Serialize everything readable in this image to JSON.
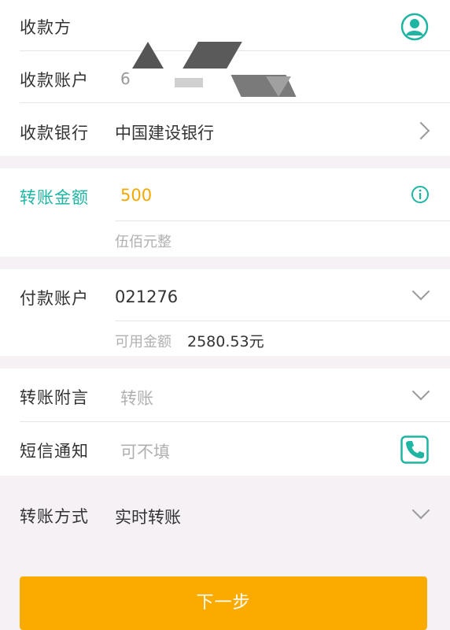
{
  "payee": {
    "label": "收款方",
    "icon": "contact-icon"
  },
  "payee_account": {
    "label": "收款账户",
    "value_visible": "6"
  },
  "payee_bank": {
    "label": "收款银行",
    "value": "中国建设银行"
  },
  "amount": {
    "label": "转账金额",
    "value": "500",
    "in_words": "伍佰元整",
    "info_icon": "info-icon"
  },
  "payer_account": {
    "label": "付款账户",
    "value": "021276",
    "balance_label": "可用金额",
    "balance_value": "2580.53元"
  },
  "memo": {
    "label": "转账附言",
    "placeholder": "转账"
  },
  "sms": {
    "label": "短信通知",
    "placeholder": "可不填",
    "phone_icon": "phone-icon"
  },
  "method": {
    "label": "转账方式",
    "value": "实时转账"
  },
  "next_button": "下一步",
  "colors": {
    "accent_teal": "#1fb5a3",
    "amount_orange": "#f5a800",
    "button_orange": "#fbab00",
    "background": "#f5f1f5"
  }
}
